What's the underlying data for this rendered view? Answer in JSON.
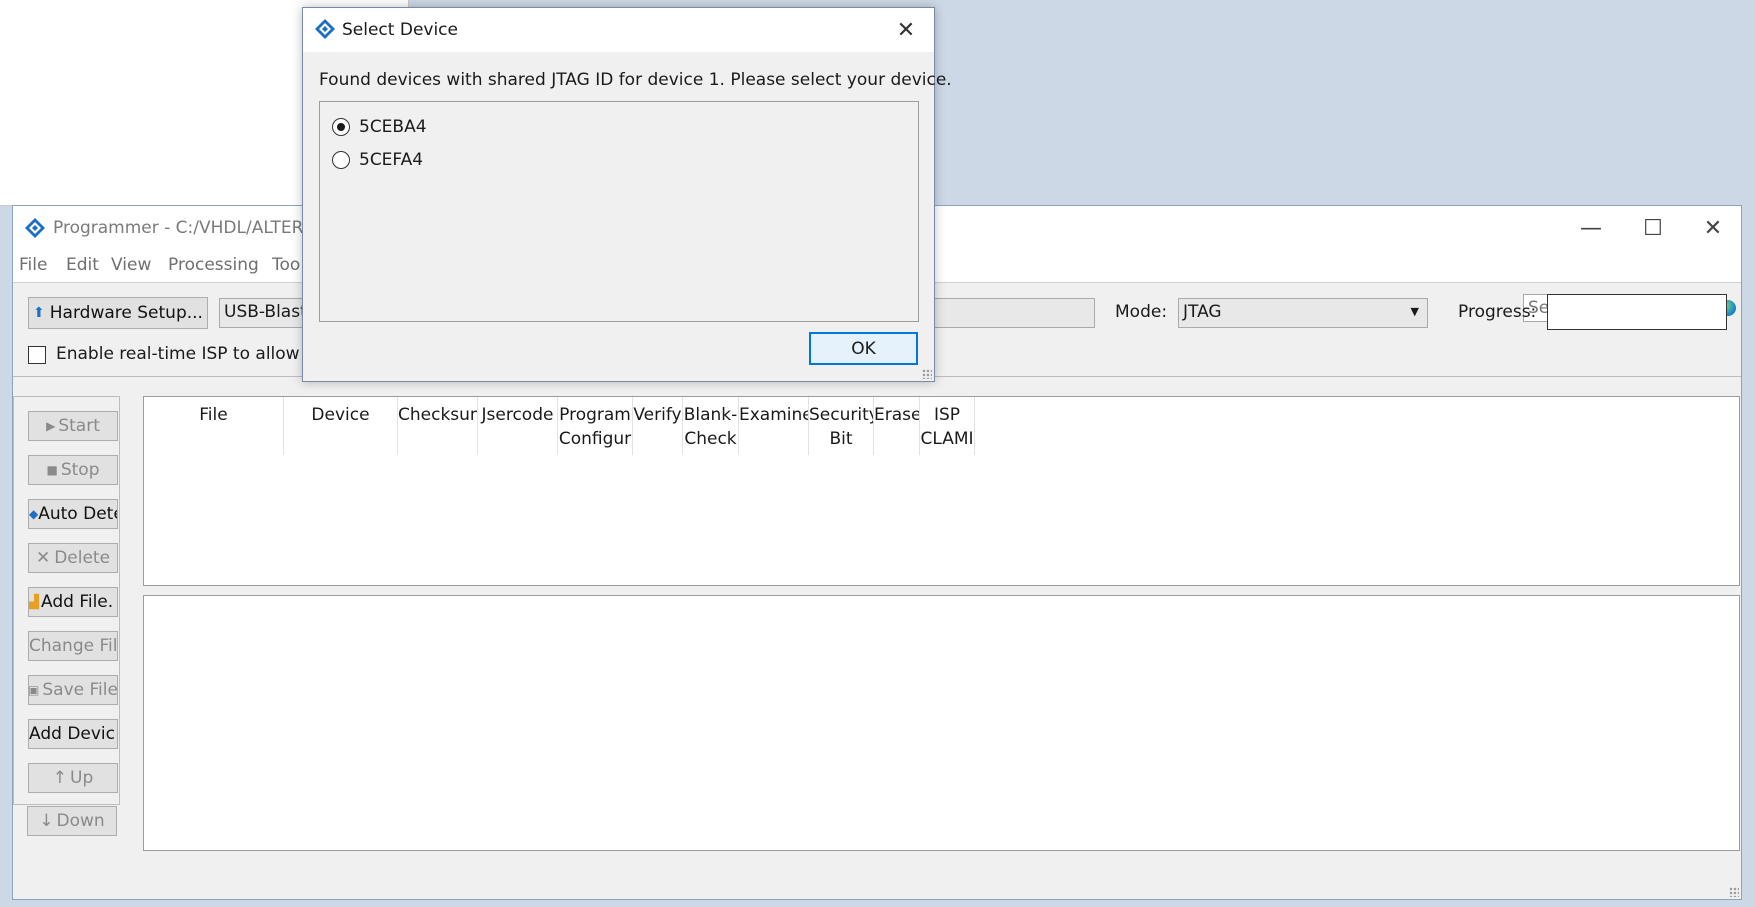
{
  "main_window": {
    "title": "Programmer - C:/VHDL/ALTERA",
    "controls": {
      "minimize": "—",
      "maximize": "☐",
      "close": "✕"
    },
    "menu": [
      "File",
      "Edit",
      "View",
      "Processing",
      "Too"
    ],
    "search_placeholder": "Search altera.com",
    "hardware_setup_label": "Hardware Setup...",
    "hardware_value": "USB-Blast",
    "mode_label": "Mode:",
    "mode_value": "JTAG",
    "progress_label": "Progress:",
    "isp_checkbox_label": "Enable real-time ISP to allow b",
    "isp_checked": false,
    "side_buttons": [
      {
        "label": "Start",
        "icon": "start-icon",
        "enabled": false
      },
      {
        "label": "Stop",
        "icon": "stop-icon",
        "enabled": false
      },
      {
        "label": "Auto Dete",
        "icon": "auto-detect-icon",
        "enabled": true
      },
      {
        "label": "Delete",
        "icon": "delete-icon",
        "enabled": false
      },
      {
        "label": "Add File.",
        "icon": "add-file-icon",
        "enabled": true
      },
      {
        "label": "Change Fil",
        "icon": "",
        "enabled": false
      },
      {
        "label": "Save File",
        "icon": "save-icon",
        "enabled": false
      },
      {
        "label": "Add Devic",
        "icon": "",
        "enabled": true
      },
      {
        "label": "Up",
        "icon": "up-icon",
        "enabled": false
      },
      {
        "label": "Down",
        "icon": "down-icon",
        "enabled": false
      }
    ],
    "table_headers": [
      {
        "line1": "File",
        "line2": ""
      },
      {
        "line1": "Device",
        "line2": ""
      },
      {
        "line1": "Checksun",
        "line2": ""
      },
      {
        "line1": "Jsercode",
        "line2": ""
      },
      {
        "line1": "Program",
        "line2": "Configur"
      },
      {
        "line1": "Verify",
        "line2": ""
      },
      {
        "line1": "Blank-",
        "line2": "Check"
      },
      {
        "line1": "Examine",
        "line2": ""
      },
      {
        "line1": "Security",
        "line2": "Bit"
      },
      {
        "line1": "Erase",
        "line2": ""
      },
      {
        "line1": "ISP",
        "line2": "CLAMI"
      }
    ]
  },
  "dialog": {
    "title": "Select Device",
    "message": "Found devices with shared JTAG ID for device 1. Please select your device.",
    "options": [
      {
        "label": "5CEBA4",
        "selected": true
      },
      {
        "label": "5CEFA4",
        "selected": false
      }
    ],
    "ok_label": "OK",
    "close_glyph": "✕"
  },
  "colors": {
    "desktop": "#cdd8e6",
    "window_bg": "#f0f0f0",
    "ok_focus": "#0078d7",
    "logo_blue": "#1c6fc6"
  }
}
